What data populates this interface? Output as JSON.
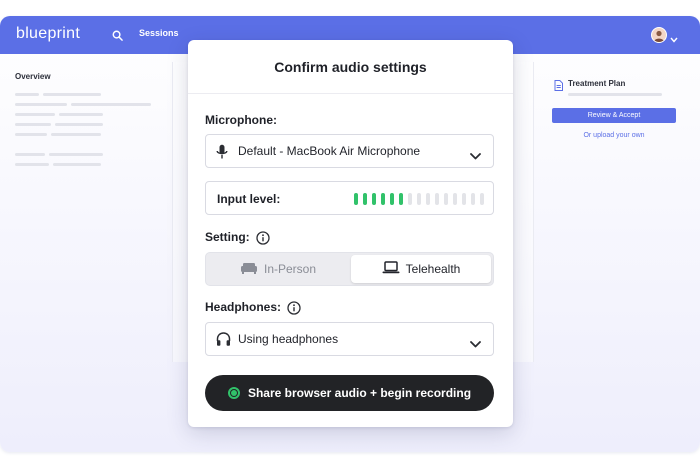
{
  "app": {
    "logo_text": "blueprint",
    "brand_color": "#5b6fe6",
    "nav_sessions": "Sessions"
  },
  "sidebar": {
    "title": "Overview"
  },
  "right_panel": {
    "title": "Treatment Plan",
    "review_button": "Review & Accept",
    "upload_link": "Or upload your own"
  },
  "modal": {
    "title": "Confirm audio settings",
    "microphone": {
      "label": "Microphone:",
      "selected": "Default - MacBook Air Microphone",
      "icon": "microphone-icon"
    },
    "input_level": {
      "label": "Input level:",
      "active_segments": 6,
      "total_segments": 15,
      "active_color": "#31c26a",
      "inactive_color": "#e3e4e8"
    },
    "setting": {
      "label": "Setting:",
      "options": [
        {
          "label": "In-Person",
          "icon": "couch-icon",
          "selected": false
        },
        {
          "label": "Telehealth",
          "icon": "laptop-icon",
          "selected": true
        }
      ]
    },
    "headphones": {
      "label": "Headphones:",
      "selected": "Using headphones",
      "icon": "headphones-icon"
    },
    "record_button": "Share browser audio + begin recording",
    "record_color": "#31c26a"
  }
}
